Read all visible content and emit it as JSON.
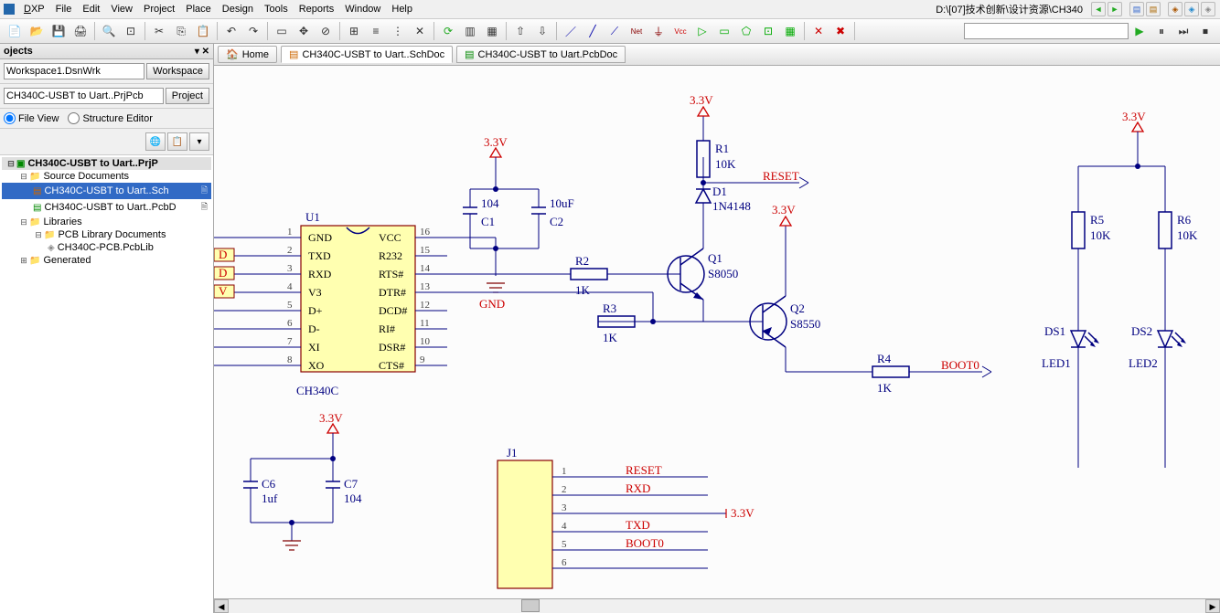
{
  "menu": {
    "items": [
      "DXP",
      "File",
      "Edit",
      "View",
      "Project",
      "Place",
      "Design",
      "Tools",
      "Reports",
      "Window",
      "Help"
    ],
    "path": "D:\\[07]技术创新\\设计资源\\CH340"
  },
  "panel": {
    "title": "ojects",
    "workspace": "Workspace1.DsnWrk",
    "workspace_btn": "Workspace",
    "project": "CH340C-USBT to Uart..PrjPcb",
    "project_btn": "Project",
    "fileview": "File View",
    "structure": "Structure Editor"
  },
  "tree": {
    "root": "CH340C-USBT to Uart..PrjP",
    "src": "Source Documents",
    "sch": "CH340C-USBT to Uart..Sch",
    "pcb": "CH340C-USBT to Uart..PcbD",
    "lib": "Libraries",
    "libdoc": "PCB Library Documents",
    "pcblib": "CH340C-PCB.PcbLib",
    "gen": "Generated"
  },
  "tabs": {
    "home": "Home",
    "t1": "CH340C-USBT to Uart..SchDoc",
    "t2": "CH340C-USBT to Uart.PcbDoc"
  },
  "sch": {
    "u1": "U1",
    "u1_part": "CH340C",
    "u1_pins_left": [
      "GND",
      "TXD",
      "RXD",
      "V3",
      "D+",
      "D-",
      "XI",
      "XO"
    ],
    "u1_pins_right": [
      "VCC",
      "R232",
      "RTS#",
      "DTR#",
      "DCD#",
      "RI#",
      "DSR#",
      "CTS#"
    ],
    "pin_nums_left": [
      "1",
      "2",
      "3",
      "4",
      "5",
      "6",
      "7",
      "8"
    ],
    "pin_nums_right": [
      "16",
      "15",
      "14",
      "13",
      "12",
      "11",
      "10",
      "9"
    ],
    "pwr_33": "3.3V",
    "gnd": "GND",
    "c1": "C1",
    "c1v": "104",
    "c2": "C2",
    "c2v": "10uF",
    "c6": "C6",
    "c6v": "1uf",
    "c7": "C7",
    "c7v": "104",
    "r1": "R1",
    "r1v": "10K",
    "r2": "R2",
    "r2v": "1K",
    "r3": "R3",
    "r3v": "1K",
    "r4": "R4",
    "r4v": "1K",
    "r5": "R5",
    "r5v": "10K",
    "r6": "R6",
    "r6v": "10K",
    "d1": "D1",
    "d1v": "1N4148",
    "q1": "Q1",
    "q1v": "S8050",
    "q2": "Q2",
    "q2v": "S8550",
    "ds1": "DS1",
    "ds1v": "LED1",
    "ds2": "DS2",
    "ds2v": "LED2",
    "net_reset": "RESET",
    "net_boot": "BOOT0",
    "net_rxd": "RXD",
    "net_txd": "TXD",
    "j1": "J1",
    "j1_pins": [
      "1",
      "2",
      "3",
      "4",
      "5",
      "6"
    ],
    "port_d": "D",
    "port_v": "V"
  }
}
